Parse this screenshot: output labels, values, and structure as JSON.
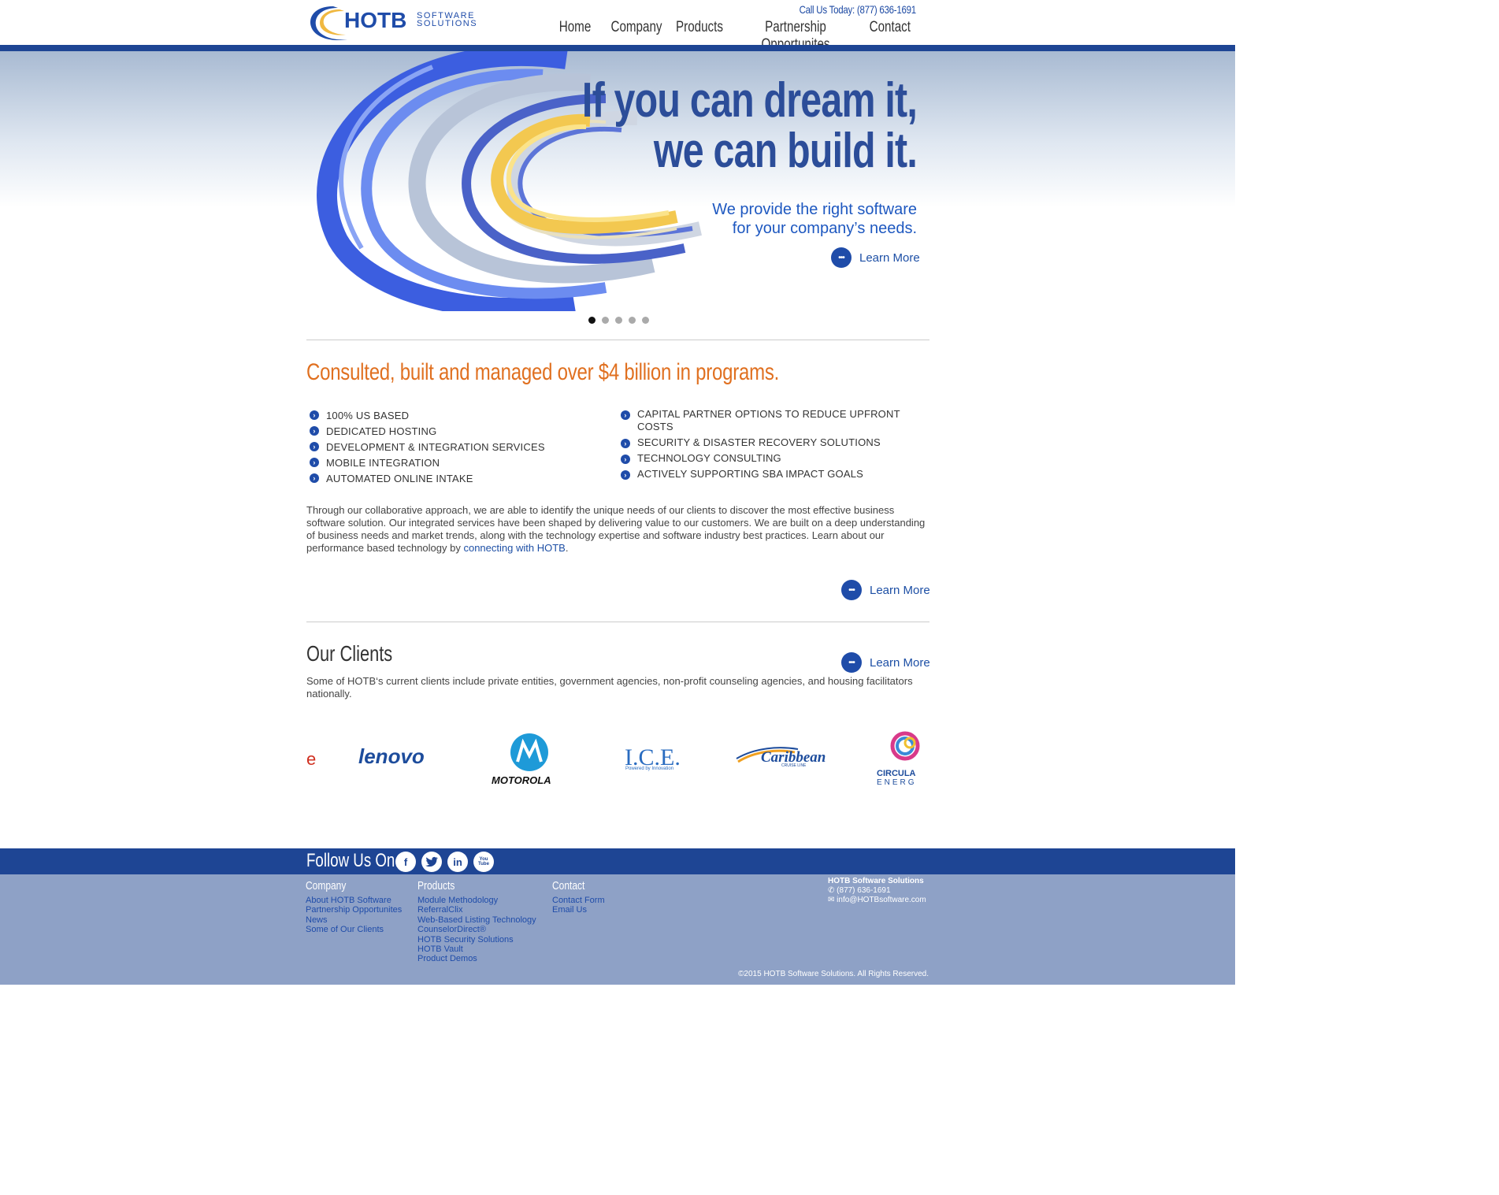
{
  "header": {
    "logo_main": "HOTB",
    "logo_sub1": "SOFTWARE",
    "logo_sub2": "SOLUTIONS",
    "phone": "Call Us Today: (877) 636-1691",
    "nav": [
      "Home",
      "Company",
      "Products",
      "Partnership Opportunites",
      "Contact"
    ]
  },
  "hero": {
    "headline_1": "If you can dream it,",
    "headline_2": "we can build it.",
    "sub_1": "We provide the right software",
    "sub_2": "for your company’s needs.",
    "learn_more": "Learn More",
    "slide_count": 5,
    "active_slide": 1
  },
  "programs": {
    "title": "Consulted, built and managed over $4 billion in programs.",
    "features_left": [
      "100% US BASED",
      "DEDICATED HOSTING",
      "DEVELOPMENT & INTEGRATION SERVICES",
      "MOBILE INTEGRATION",
      "AUTOMATED ONLINE INTAKE"
    ],
    "features_right": [
      "CAPITAL PARTNER OPTIONS TO REDUCE UPFRONT COSTS",
      "SECURITY & DISASTER RECOVERY SOLUTIONS",
      "TECHNOLOGY CONSULTING",
      "ACTIVELY SUPPORTING SBA IMPACT GOALS"
    ],
    "paragraph": "Through our collaborative approach, we are able to identify the unique needs of our clients to discover the most effective business software solution. Our integrated services have been shaped by delivering value to our customers. We are built on a deep understanding of business needs and market trends, along with the technology expertise and software industry best practices. Learn about our performance based technology by ",
    "paragraph_link": "connecting with HOTB",
    "paragraph_end": ".",
    "learn_more": "Learn More"
  },
  "clients": {
    "title": "Our Clients",
    "learn_more": "Learn More",
    "description": "Some of HOTB‘s current clients include private entities, government agencies, non-profit counseling agencies, and housing facilitators nationally.",
    "logos": {
      "partial_left": "e",
      "lenovo": "lenovo",
      "motorola": "MOTOROLA",
      "ice": "I.C.E.",
      "ice_tag": "Powered by Innovation",
      "caribbean": "Caribbean",
      "caribbean_tag": "CRUISE LINE",
      "circular_1": "CIRCULA",
      "circular_2": "ENERG"
    }
  },
  "footer": {
    "follow": "Follow Us On...",
    "social": [
      "f",
      "t",
      "in",
      "You Tube"
    ],
    "company_title": "Company",
    "company_links": [
      "About HOTB Software",
      "Partnership Opportunites",
      "News",
      "Some of Our Clients"
    ],
    "products_title": "Products",
    "products_links": [
      "Module Methodology",
      "ReferralClix",
      "Web-Based Listing Technology",
      "CounselorDirect®",
      "HOTB Security Solutions",
      "HOTB Vault",
      "Product Demos"
    ],
    "contact_title": "Contact",
    "contact_links": [
      "Contact Form",
      "Email Us"
    ],
    "info_name": "HOTB Software Solutions",
    "info_phone": "(877) 636-1691",
    "info_email": "info@HOTBsoftware.com",
    "copyright": "©2015 HOTB Software Solutions. All Rights Reserved."
  },
  "colors": {
    "brand_blue": "#1e4594",
    "accent_orange": "#e07020",
    "footer_light": "#8ea1c6"
  }
}
